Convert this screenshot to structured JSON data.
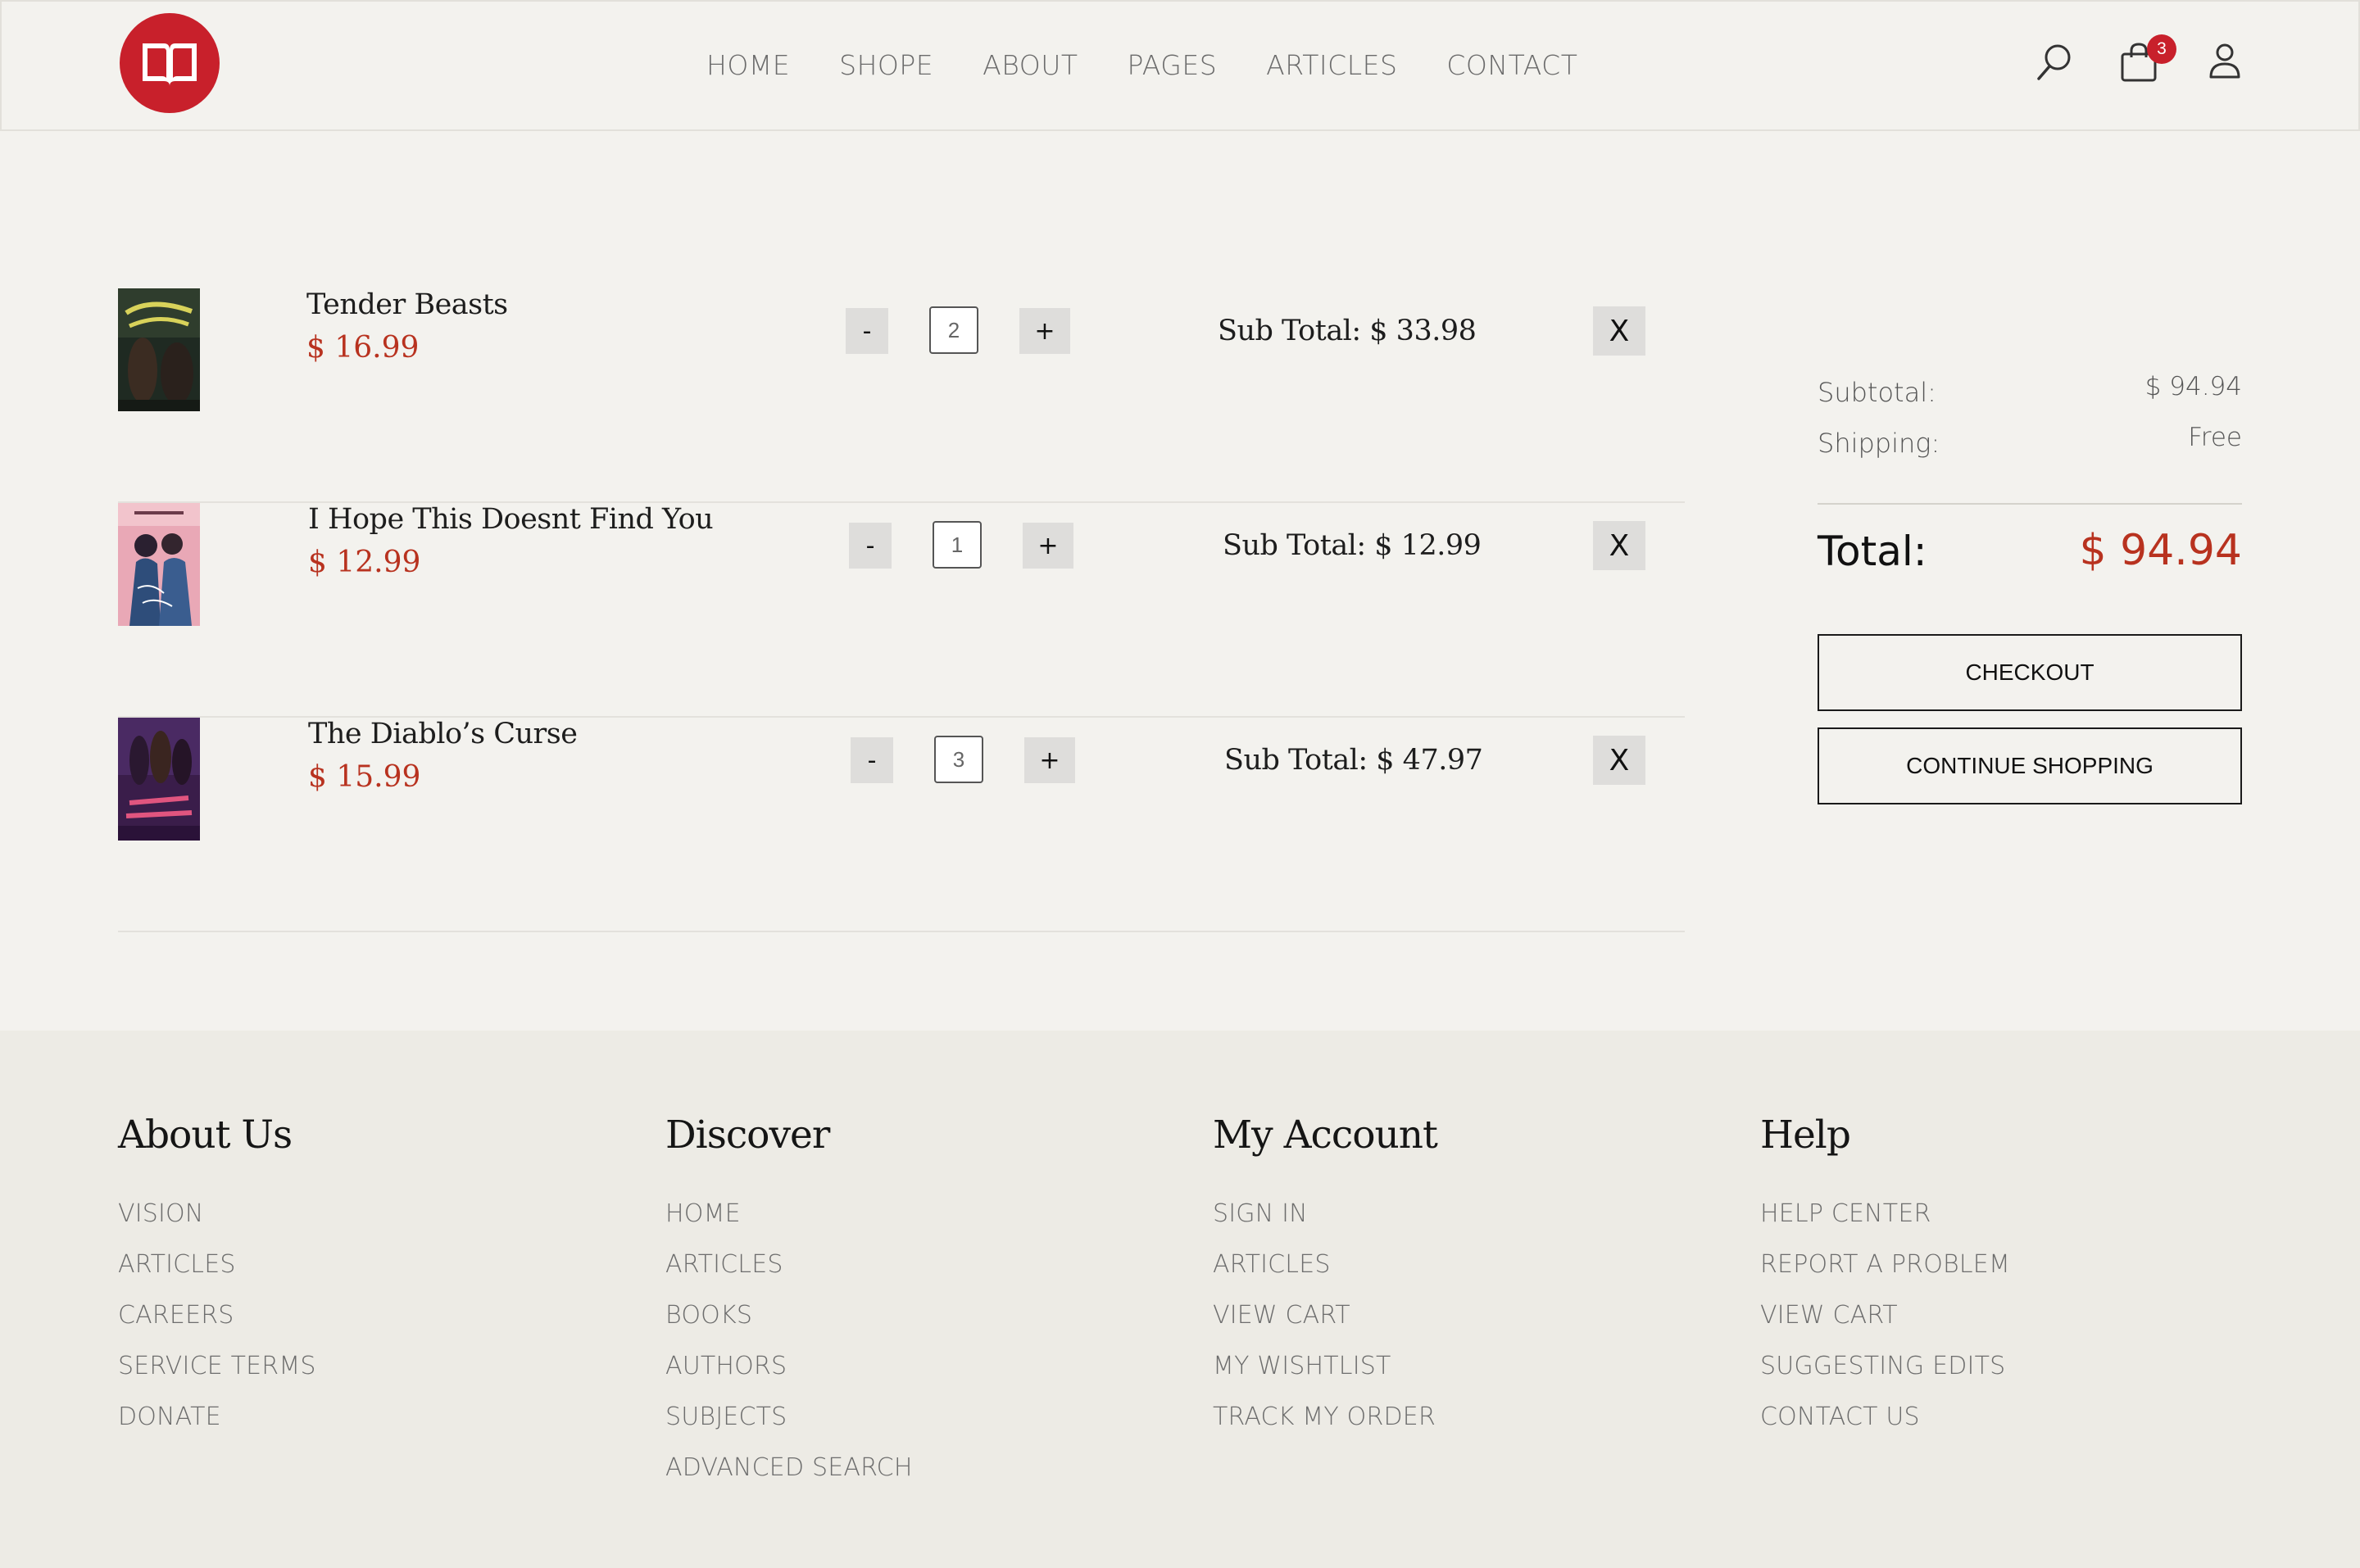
{
  "header": {
    "cart_count": "3",
    "nav": [
      "HOME",
      "SHOPE",
      "ABOUT",
      "PAGES",
      "ARTICLES",
      "CONTACT"
    ]
  },
  "cart": {
    "items": [
      {
        "title": "Tender Beasts",
        "price": "$ 16.99",
        "quantity": "2",
        "subtotal": "Sub Total: $ 33.98",
        "minus": "-",
        "plus": "+",
        "remove": "X"
      },
      {
        "title": "I Hope This Doesnt Find You",
        "price": "$ 12.99",
        "quantity": "1",
        "subtotal": "Sub Total: $ 12.99",
        "minus": "-",
        "plus": "+",
        "remove": "X"
      },
      {
        "title": "The Diablo’s Curse",
        "price": "$ 15.99",
        "quantity": "3",
        "subtotal": "Sub Total: $ 47.97",
        "minus": "-",
        "plus": "+",
        "remove": "X"
      }
    ]
  },
  "summary": {
    "subtotal_label": "Subtotal:",
    "subtotal_value": "$ 94.94",
    "shipping_label": "Shipping:",
    "shipping_value": "Free",
    "total_label": "Total:",
    "total_value": "$ 94.94",
    "checkout_label": "CHECKOUT",
    "continue_label": "CONTINUE SHOPPING"
  },
  "footer": {
    "columns": [
      {
        "title": "About Us",
        "links": [
          "VISION",
          "ARTICLES",
          "CAREERS",
          "SERVICE TERMS",
          "DONATE"
        ]
      },
      {
        "title": "Discover",
        "links": [
          "HOME",
          "ARTICLES",
          "BOOKS",
          "AUTHORS",
          "SUBJECTS",
          "ADVANCED SEARCH"
        ]
      },
      {
        "title": "My Account",
        "links": [
          "SIGN IN",
          "ARTICLES",
          "VIEW CART",
          "MY WISHTLIST",
          "TRACK MY ORDER"
        ]
      },
      {
        "title": "Help",
        "links": [
          "HELP CENTER",
          "REPORT A PROBLEM",
          "VIEW CART",
          "SUGGESTING EDITS",
          "CONTACT US"
        ]
      }
    ]
  },
  "colors": {
    "brand": "#c8202b",
    "price": "#b8321f",
    "background": "#f3f2ee",
    "footer_background": "#edebe5"
  },
  "icons": [
    "open-book-logo-icon",
    "search-icon",
    "shopping-bag-icon",
    "user-icon"
  ]
}
